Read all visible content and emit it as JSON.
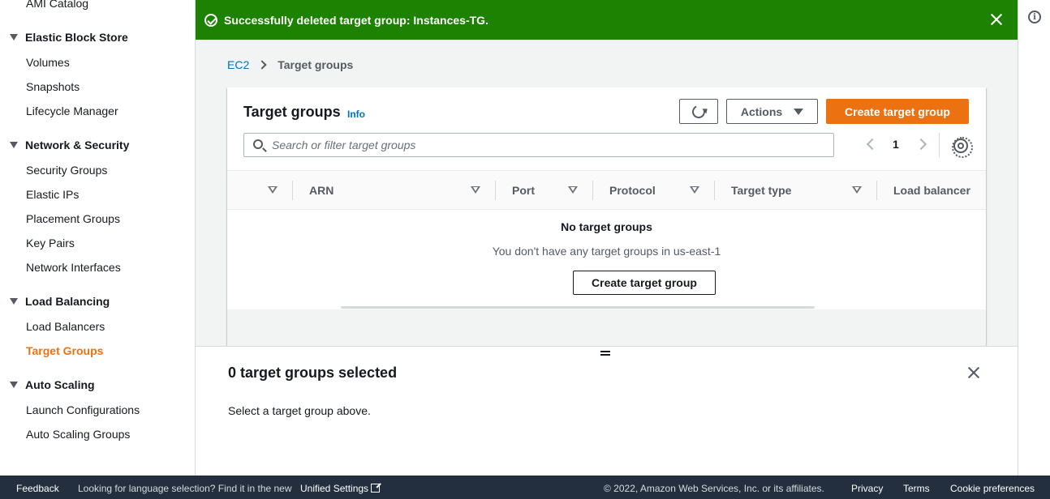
{
  "sidebar": {
    "top_item": "AMI Catalog",
    "sections": [
      {
        "label": "Elastic Block Store",
        "items": [
          "Volumes",
          "Snapshots",
          "Lifecycle Manager"
        ]
      },
      {
        "label": "Network & Security",
        "items": [
          "Security Groups",
          "Elastic IPs",
          "Placement Groups",
          "Key Pairs",
          "Network Interfaces"
        ]
      },
      {
        "label": "Load Balancing",
        "items": [
          "Load Balancers",
          "Target Groups"
        ]
      },
      {
        "label": "Auto Scaling",
        "items": [
          "Launch Configurations",
          "Auto Scaling Groups"
        ]
      }
    ],
    "active_item": "Target Groups"
  },
  "flash": {
    "message": "Successfully deleted target group: Instances-TG."
  },
  "breadcrumb": {
    "root": "EC2",
    "current": "Target groups"
  },
  "panel": {
    "title": "Target groups",
    "info_label": "Info",
    "actions_label": "Actions",
    "create_label": "Create target group",
    "search_placeholder": "Search or filter target groups",
    "page": "1",
    "columns": [
      "ARN",
      "Port",
      "Protocol",
      "Target type",
      "Load balancer"
    ],
    "empty_title": "No target groups",
    "empty_desc": "You don't have any target groups in us-east-1",
    "empty_create_label": "Create target group"
  },
  "split_panel": {
    "title": "0 target groups selected",
    "description": "Select a target group above."
  },
  "footer": {
    "feedback": "Feedback",
    "language_note": "Looking for language selection? Find it in the new",
    "unified_settings": "Unified Settings",
    "copyright": "© 2022, Amazon Web Services, Inc. or its affiliates.",
    "privacy": "Privacy",
    "terms": "Terms",
    "cookie": "Cookie preferences"
  },
  "colors": {
    "flash_success": "#1d8102",
    "primary_orange": "#ec7211",
    "link_blue": "#0073bb",
    "footer_bg": "#232f3e"
  }
}
